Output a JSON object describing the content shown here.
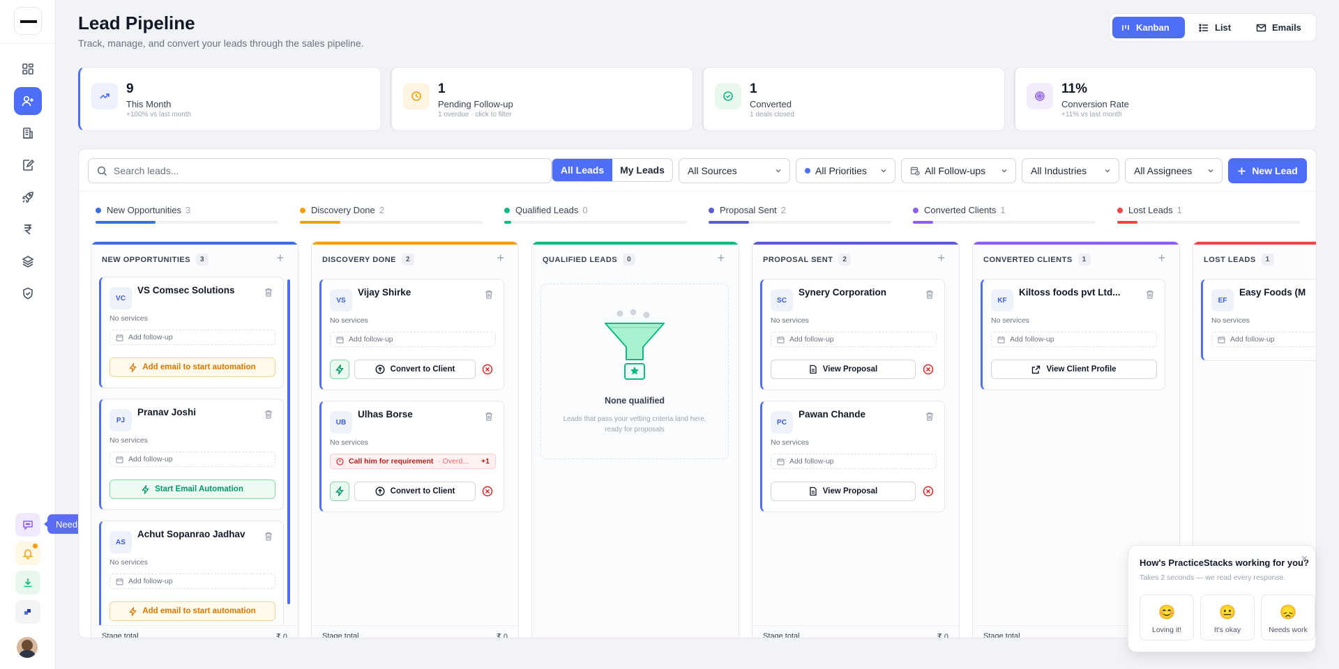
{
  "page": {
    "title": "Lead Pipeline",
    "subtitle": "Track, manage, and convert your leads through the sales pipeline."
  },
  "view_switch": {
    "kanban": "Kanban",
    "list": "List",
    "emails": "Emails",
    "active": "Kanban"
  },
  "sidebar": {
    "items": [
      "dashboard",
      "leads",
      "clients",
      "documents",
      "launch",
      "billing",
      "services",
      "compliance"
    ],
    "active": "leads",
    "help_label": "Need help?"
  },
  "stats": [
    {
      "value": "9",
      "label": "This Month",
      "sub": "+100% vs last month"
    },
    {
      "value": "1",
      "label": "Pending Follow-up",
      "sub": "1 overdue · click to filter"
    },
    {
      "value": "1",
      "label": "Converted",
      "sub": "1 deals closed"
    },
    {
      "value": "11%",
      "label": "Conversion Rate",
      "sub": "+11% vs last month"
    }
  ],
  "toolbar": {
    "search_placeholder": "Search leads...",
    "all_leads": "All Leads",
    "my_leads": "My Leads",
    "sources": "All Sources",
    "priorities": "All Priorities",
    "followups": "All Follow-ups",
    "industries": "All Industries",
    "assignees": "All Assignees",
    "new_lead": "New Lead"
  },
  "progress": [
    {
      "label": "New Opportunities",
      "count": "3",
      "color": "#3b6fe0",
      "fill": 0.33
    },
    {
      "label": "Discovery Done",
      "count": "2",
      "color": "#f59e0b",
      "fill": 0.22
    },
    {
      "label": "Qualified Leads",
      "count": "0",
      "color": "#10b981",
      "fill": 0.04
    },
    {
      "label": "Proposal Sent",
      "count": "2",
      "color": "#5b5bd6",
      "fill": 0.22
    },
    {
      "label": "Converted Clients",
      "count": "1",
      "color": "#8b5cf6",
      "fill": 0.11
    },
    {
      "label": "Lost Leads",
      "count": "1",
      "color": "#ef4444",
      "fill": 0.11
    }
  ],
  "columns": {
    "new": {
      "title": "NEW OPPORTUNITIES",
      "count": "3",
      "stage_total": "Stage total",
      "amount": "₹ 0",
      "cards": [
        {
          "initials": "VC",
          "name": "VS Comsec Solutions",
          "services": "No services",
          "followup": "Add follow-up",
          "action": "Add email to start automation"
        },
        {
          "initials": "PJ",
          "name": "Pranav Joshi",
          "services": "No services",
          "followup": "Add follow-up",
          "action": "Start Email Automation"
        },
        {
          "initials": "AS",
          "name": "Achut Sopanrao Jadhav",
          "services": "No services",
          "followup": "Add follow-up",
          "action": "Add email to start automation"
        }
      ]
    },
    "discovery": {
      "title": "DISCOVERY DONE",
      "count": "2",
      "stage_total": "Stage total",
      "amount": "₹ 0",
      "cards": [
        {
          "initials": "VS",
          "name": "Vijay Shirke",
          "services": "No services",
          "followup": "Add follow-up",
          "action": "Convert to Client"
        },
        {
          "initials": "UB",
          "name": "Ulhas Borse",
          "services": "No services",
          "task": "Call him for requirement",
          "task_status": "· Overd...",
          "extra": "+1",
          "action": "Convert to Client"
        }
      ]
    },
    "qualified": {
      "title": "QUALIFIED LEADS",
      "count": "0",
      "empty_title": "None qualified",
      "empty_desc": "Leads that pass your vetting criteria land here, ready for proposals"
    },
    "proposal": {
      "title": "PROPOSAL SENT",
      "count": "2",
      "stage_total": "Stage total",
      "amount": "₹ 0",
      "cards": [
        {
          "initials": "SC",
          "name": "Synery Corporation",
          "services": "No services",
          "followup": "Add follow-up",
          "action": "View Proposal"
        },
        {
          "initials": "PC",
          "name": "Pawan Chande",
          "services": "No services",
          "followup": "Add follow-up",
          "action": "View Proposal"
        }
      ]
    },
    "converted": {
      "title": "CONVERTED CLIENTS",
      "count": "1",
      "stage_total": "Stage total",
      "cards": [
        {
          "initials": "KF",
          "name": "Kiltoss foods pvt Ltd...",
          "services": "No services",
          "followup": "Add follow-up",
          "action": "View Client Profile"
        }
      ]
    },
    "lost": {
      "title": "LOST LEADS",
      "count": "1",
      "cards": [
        {
          "initials": "EF",
          "name": "Easy Foods (M",
          "services": "No services",
          "followup": "Add follow-up"
        }
      ]
    }
  },
  "survey": {
    "question": "How's PracticeStacks working for you?",
    "sub": "Takes 2 seconds — we read every response.",
    "options": [
      {
        "emoji": "😊",
        "label": "Loving it!"
      },
      {
        "emoji": "😐",
        "label": "It's okay"
      },
      {
        "emoji": "😞",
        "label": "Needs work"
      }
    ]
  }
}
